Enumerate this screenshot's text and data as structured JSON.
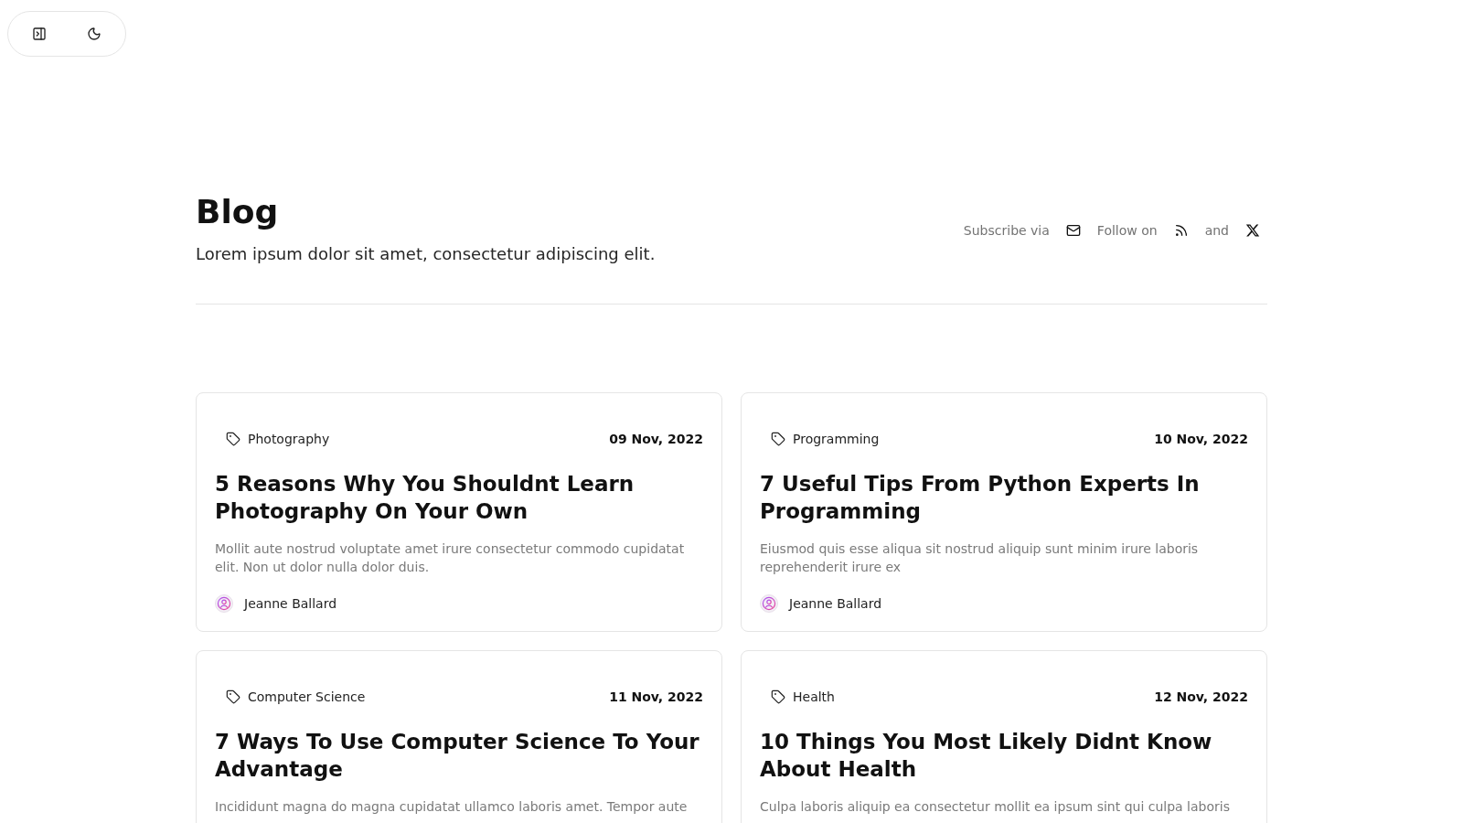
{
  "header": {
    "title": "Blog",
    "subtitle": "Lorem ipsum dolor sit amet, consectetur adipiscing elit.",
    "social": [
      {
        "kind": "label",
        "text": "Subscribe via"
      },
      {
        "kind": "email"
      },
      {
        "kind": "label",
        "text": "Follow on"
      },
      {
        "kind": "rss"
      },
      {
        "kind": "label",
        "text": "and"
      },
      {
        "kind": "x"
      }
    ]
  },
  "posts": [
    {
      "category": "Photography",
      "date": "09 Nov, 2022",
      "title": "5 Reasons Why You Shouldnt Learn Photography On Your Own",
      "excerpt": "Mollit aute nostrud voluptate amet irure consectetur commodo cupidatat elit. Non ut dolor nulla dolor duis.",
      "author": "Jeanne Ballard"
    },
    {
      "category": "Programming",
      "date": "10 Nov, 2022",
      "title": "7 Useful Tips From Python Experts In Programming",
      "excerpt": "Eiusmod quis esse aliqua sit nostrud aliquip sunt minim irure laboris reprehenderit irure ex",
      "author": "Jeanne Ballard"
    },
    {
      "category": "Computer Science",
      "date": "11 Nov, 2022",
      "title": "7 Ways To Use Computer Science To Your Advantage",
      "excerpt": "Incididunt magna do magna cupidatat ullamco laboris amet. Tempor aute"
    },
    {
      "category": "Health",
      "date": "12 Nov, 2022",
      "title": "10 Things You Most Likely Didnt Know About Health",
      "excerpt": "Culpa laboris aliquip ea consectetur mollit ea ipsum sint qui culpa laboris"
    }
  ]
}
